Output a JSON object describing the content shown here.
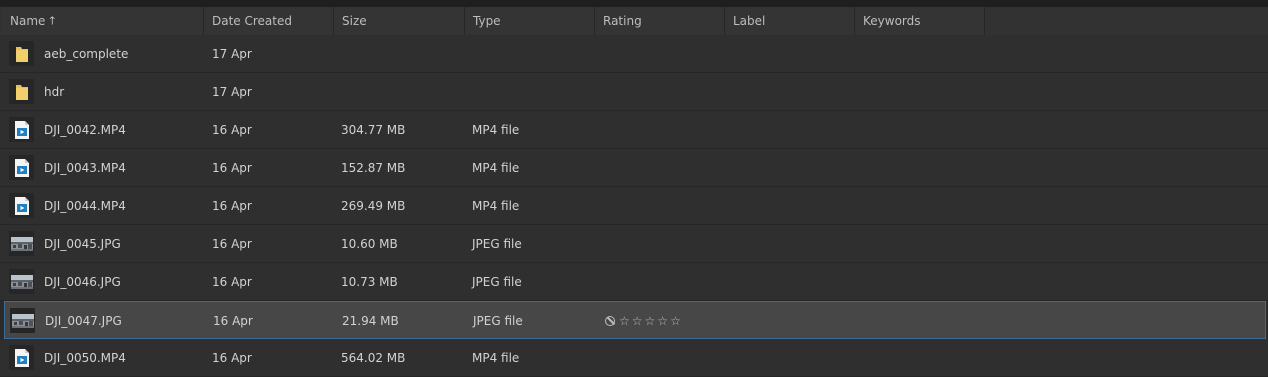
{
  "columns": [
    {
      "key": "name",
      "label": "Name",
      "sorted": "ascending"
    },
    {
      "key": "date",
      "label": "Date Created"
    },
    {
      "key": "size",
      "label": "Size"
    },
    {
      "key": "type",
      "label": "Type"
    },
    {
      "key": "rating",
      "label": "Rating"
    },
    {
      "key": "label",
      "label": "Label"
    },
    {
      "key": "keywords",
      "label": "Keywords"
    }
  ],
  "sort_arrow": "🡑",
  "rows": [
    {
      "name": "aeb_complete",
      "date": "17 Apr",
      "size": "",
      "type": "",
      "icon": "folder-icon",
      "selected": false
    },
    {
      "name": "hdr",
      "date": "17 Apr",
      "size": "",
      "type": "",
      "icon": "folder-icon",
      "selected": false
    },
    {
      "name": "DJI_0042.MP4",
      "date": "16 Apr",
      "size": "304.77 MB",
      "type": "MP4 file",
      "icon": "video-file-icon",
      "selected": false
    },
    {
      "name": "DJI_0043.MP4",
      "date": "16 Apr",
      "size": "152.87 MB",
      "type": "MP4 file",
      "icon": "video-file-icon",
      "selected": false
    },
    {
      "name": "DJI_0044.MP4",
      "date": "16 Apr",
      "size": "269.49 MB",
      "type": "MP4 file",
      "icon": "video-file-icon",
      "selected": false
    },
    {
      "name": "DJI_0045.JPG",
      "date": "16 Apr",
      "size": "10.60 MB",
      "type": "JPEG file",
      "icon": "image-thumbnail-icon",
      "selected": false
    },
    {
      "name": "DJI_0046.JPG",
      "date": "16 Apr",
      "size": "10.73 MB",
      "type": "JPEG file",
      "icon": "image-thumbnail-icon",
      "selected": false
    },
    {
      "name": "DJI_0047.JPG",
      "date": "16 Apr",
      "size": "21.94 MB",
      "type": "JPEG file",
      "icon": "image-thumbnail-icon",
      "selected": true,
      "rating": {
        "stars": 0,
        "max": 5
      }
    },
    {
      "name": "DJI_0050.MP4",
      "date": "16 Apr",
      "size": "564.02 MB",
      "type": "MP4 file",
      "icon": "video-file-icon",
      "selected": false
    }
  ],
  "colors": {
    "background": "#2b2b2b",
    "row": "#2f2f2f",
    "selected_row": "#474747",
    "selected_border": "#3e6c99",
    "folder": "#e8c15b",
    "video_icon_accent": "#1f7fbf",
    "text": "#d2d2d2"
  }
}
